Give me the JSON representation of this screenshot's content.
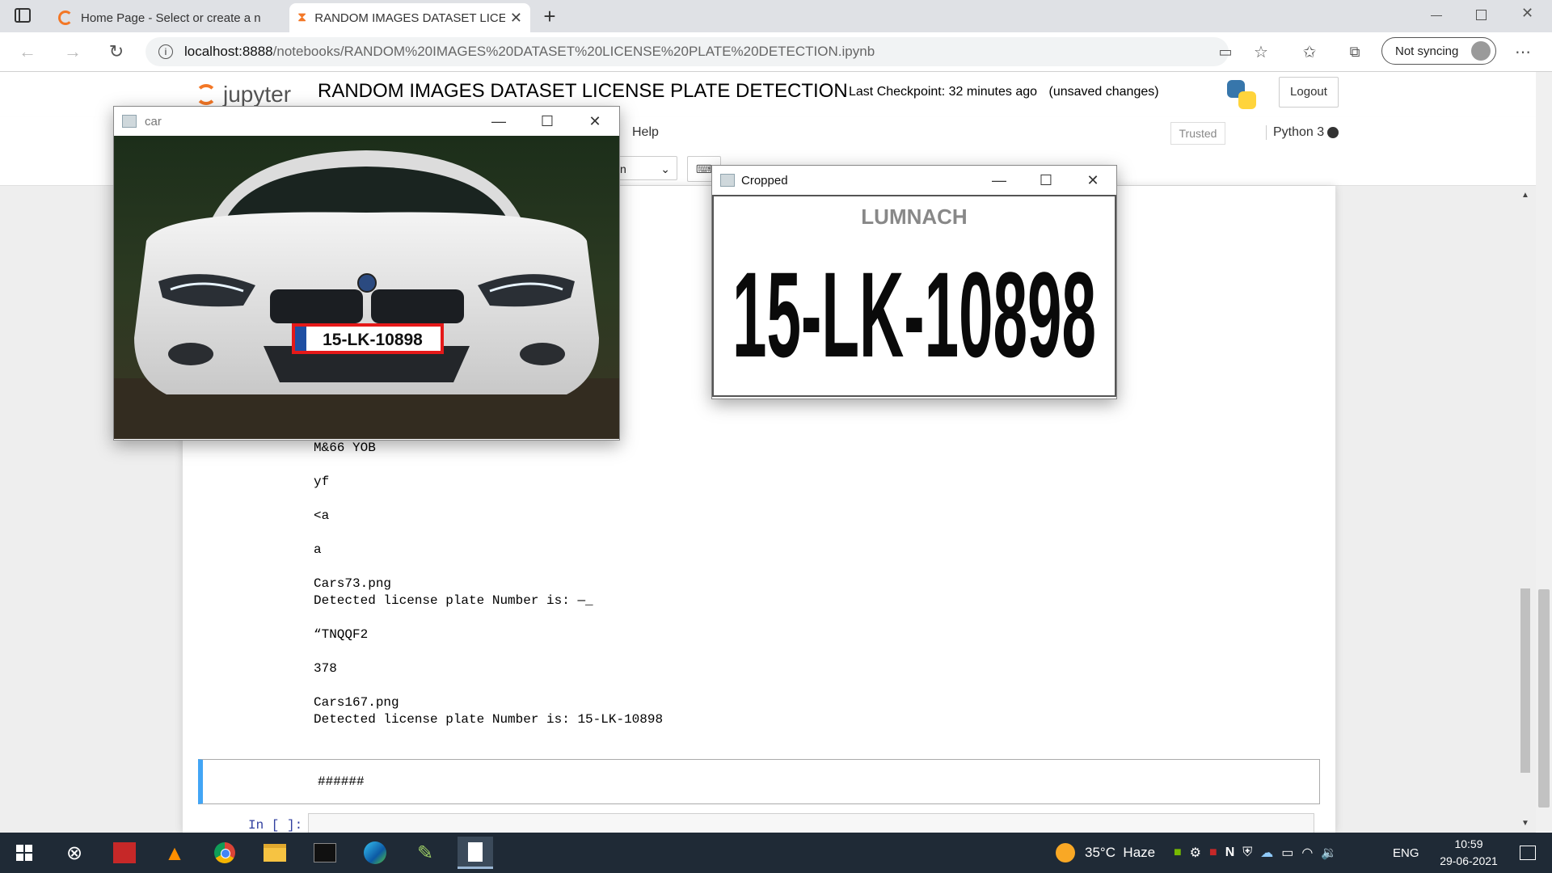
{
  "browser": {
    "tabs": [
      {
        "label": "Home Page - Select or create a n",
        "icon": "jupyter-spinner-icon"
      },
      {
        "label": "RANDOM IMAGES DATASET LICE",
        "icon": "hourglass-icon"
      }
    ],
    "url_prefix": "localhost:8888",
    "url_path": "/notebooks/RANDOM%20IMAGES%20DATASET%20LICENSE%20PLATE%20DETECTION.ipynb",
    "sync_label": "Not syncing"
  },
  "jupyter": {
    "logo_text": "jupyter",
    "notebook_title": "RANDOM IMAGES DATASET LICENSE PLATE DETECTION",
    "checkpoint": "Last Checkpoint: 32 minutes ago",
    "unsaved": "(unsaved changes)",
    "logout_label": "Logout",
    "menu_help": "Help",
    "trusted_label": "Trusted",
    "kernel_label": "Python 3",
    "celltype_partial": "n"
  },
  "output_lines": [
    "M&66 YOB",
    "yf",
    "<a",
    "a",
    "Cars73.png",
    "Detected license plate Number is: —_",
    "“TNQQF2",
    "378",
    "Cars167.png",
    "Detected license plate Number is: 15-LK-10898"
  ],
  "markdown_cell": {
    "text": "######"
  },
  "input_prompt": "In [ ]:",
  "car_window": {
    "title": "car",
    "plate_text": "15-LK-10898"
  },
  "cropped_window": {
    "title": "Cropped",
    "plate_top_text": "LUMNACH",
    "plate_text": "15-LK-10898"
  },
  "taskbar": {
    "weather": "35°C  Haze",
    "language": "ENG",
    "time": "10:59",
    "date": "29-06-2021"
  },
  "colors": {
    "jupyter_orange": "#F37726",
    "cell_selected_bar": "#42A5F5",
    "plate_red": "#e51919",
    "taskbar_bg": "#1f2a36"
  }
}
